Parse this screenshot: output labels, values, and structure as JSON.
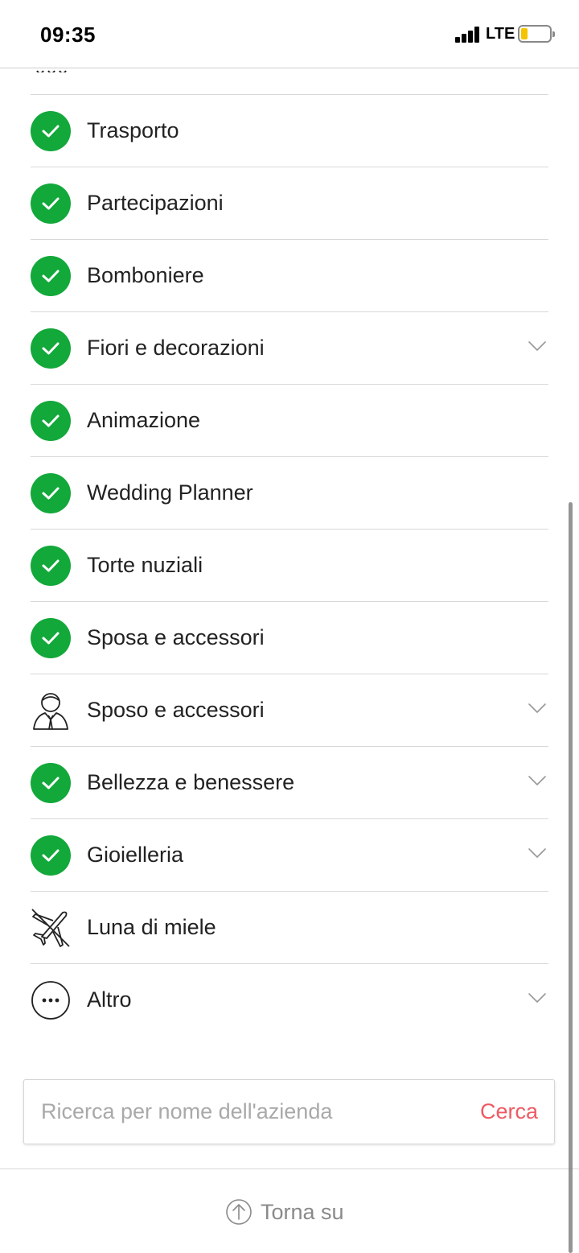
{
  "status_bar": {
    "time": "09:35",
    "network": "LTE"
  },
  "categories": [
    {
      "label": "Trasporto",
      "icon": "check-icon",
      "has_submenu": false
    },
    {
      "label": "Partecipazioni",
      "icon": "check-icon",
      "has_submenu": false
    },
    {
      "label": "Bomboniere",
      "icon": "check-icon",
      "has_submenu": false
    },
    {
      "label": "Fiori e decorazioni",
      "icon": "check-icon",
      "has_submenu": true
    },
    {
      "label": "Animazione",
      "icon": "check-icon",
      "has_submenu": false
    },
    {
      "label": "Wedding Planner",
      "icon": "check-icon",
      "has_submenu": false
    },
    {
      "label": "Torte nuziali",
      "icon": "check-icon",
      "has_submenu": false
    },
    {
      "label": "Sposa e accessori",
      "icon": "check-icon",
      "has_submenu": false
    },
    {
      "label": "Sposo e accessori",
      "icon": "groom-icon",
      "has_submenu": true
    },
    {
      "label": "Bellezza e benessere",
      "icon": "check-icon",
      "has_submenu": true
    },
    {
      "label": "Gioielleria",
      "icon": "check-icon",
      "has_submenu": true
    },
    {
      "label": "Luna di miele",
      "icon": "airplane-icon",
      "has_submenu": false
    },
    {
      "label": "Altro",
      "icon": "more-icon",
      "has_submenu": true
    }
  ],
  "search": {
    "placeholder": "Ricerca per nome dell'azienda",
    "button_label": "Cerca"
  },
  "footer": {
    "back_to_top_label": "Torna su"
  },
  "colors": {
    "check_green": "#12a83a",
    "search_button": "#ef5a64",
    "battery_low": "#f5c400"
  }
}
